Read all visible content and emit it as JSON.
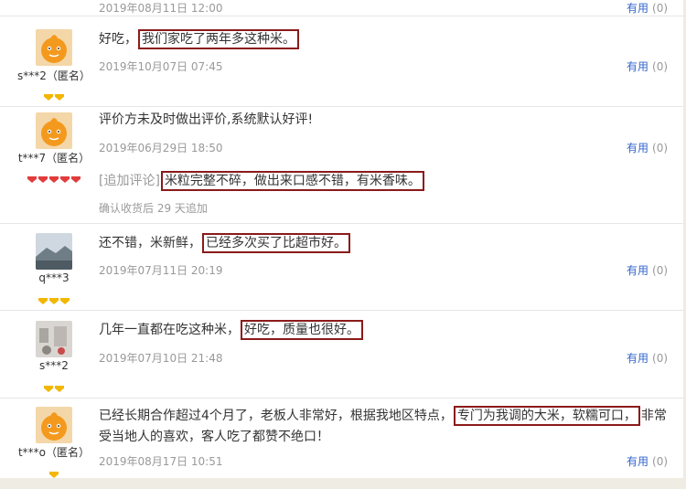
{
  "reviews": [
    {
      "date": "2019年08月11日 12:00",
      "useful_label": "有用",
      "useful_count": "(0)"
    },
    {
      "user": "s***2（匿名）",
      "text_before": "好吃，",
      "text_highlight": "我们家吃了两年多这种米。",
      "text_after": "",
      "date": "2019年10月07日 07:45",
      "useful_label": "有用",
      "useful_count": "(0)",
      "level_color": "#f2b705",
      "level_count": 2
    },
    {
      "user": "t***7（匿名）",
      "text": "评价方未及时做出评价,系统默认好评!",
      "date": "2019年06月29日 18:50",
      "useful_label": "有用",
      "useful_count": "(0)",
      "append_label": "[追加评论]",
      "append_highlight": "米粒完整不碎，做出来口感不错，有米香味。",
      "append_meta": "确认收货后 29 天追加",
      "level_color": "#e23c3c",
      "level_count": 5
    },
    {
      "user": "q***3",
      "text_before": "还不错，米新鲜，",
      "text_highlight": "已经多次买了比超市好。",
      "text_after": "",
      "date": "2019年07月11日 20:19",
      "useful_label": "有用",
      "useful_count": "(0)",
      "level_color": "#f2b705",
      "level_count": 3
    },
    {
      "user": "s***2",
      "text_before": "几年一直都在吃这种米，",
      "text_highlight": "好吃，质量也很好。",
      "text_after": "",
      "date": "2019年07月10日 21:48",
      "useful_label": "有用",
      "useful_count": "(0)",
      "level_color": "#f2b705",
      "level_count": 2
    },
    {
      "user": "t***o（匿名）",
      "text_before": "已经长期合作超过4个月了，老板人非常好，根据我地区特点，",
      "text_highlight": "专门为我调的大米，软糯可口，",
      "text_after": "非常受当地人的喜欢，客人吃了都赞不绝口！",
      "date": "2019年08月17日 10:51",
      "useful_label": "有用",
      "useful_count": "(0)",
      "level_color": "#f2b705",
      "level_count": 1
    }
  ]
}
